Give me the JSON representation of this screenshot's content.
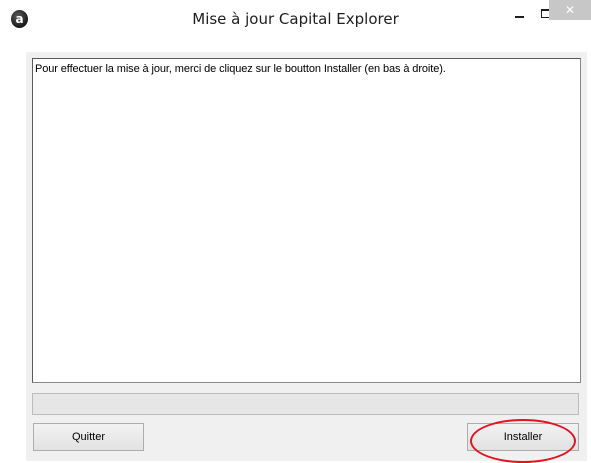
{
  "window": {
    "title": "Mise à jour Capital Explorer",
    "app_icon_glyph": "a",
    "controls": {
      "minimize_icon": "minimize-icon",
      "maximize_icon": "maximize-icon",
      "close_glyph": "✕"
    }
  },
  "message": {
    "text": "Pour effectuer la mise à jour, merci de cliquez sur le boutton Installer (en bas à droite)."
  },
  "progress": {
    "value": 0
  },
  "buttons": {
    "quit_label": "Quitter",
    "install_label": "Installer"
  },
  "colors": {
    "highlight": "#e2141f",
    "close_button": "#c7c7c7",
    "progress_fill": "#06b025"
  }
}
